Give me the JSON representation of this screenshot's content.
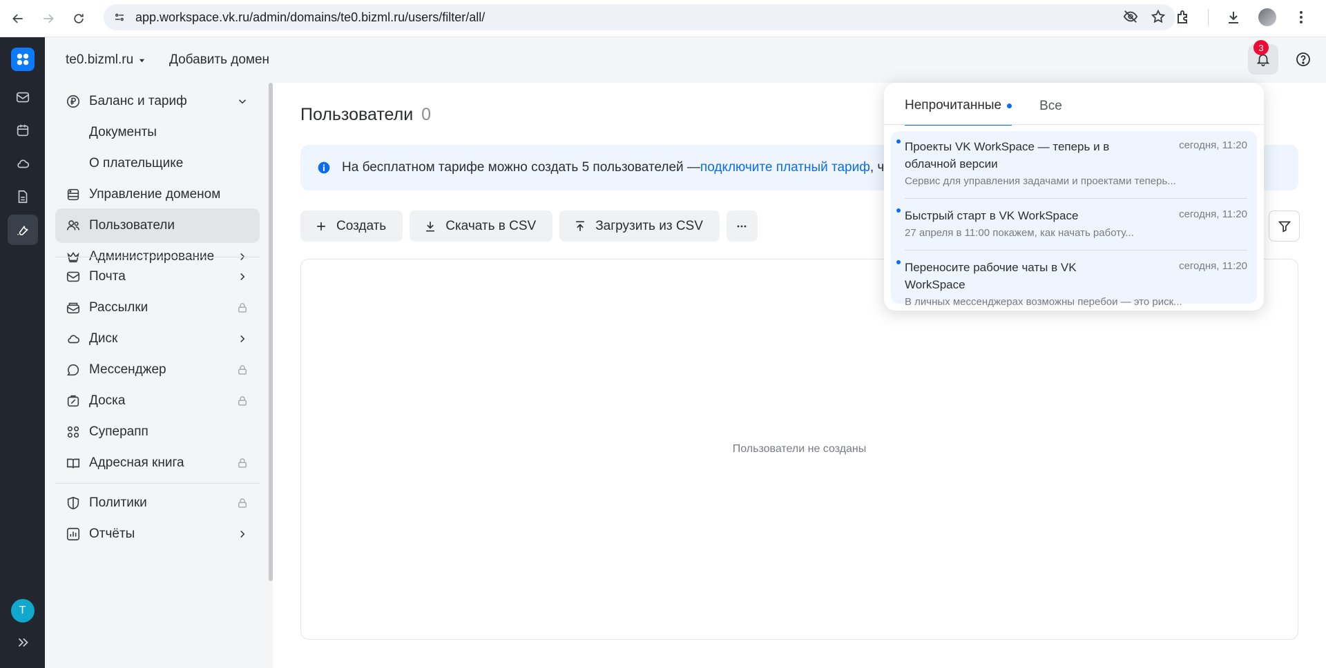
{
  "browser": {
    "url": "app.workspace.vk.ru/admin/domains/te0.bizml.ru/users/filter/all/"
  },
  "rail": {
    "avatar_letter": "T",
    "items": [
      "mail-icon",
      "calendar-icon",
      "cloud-icon",
      "document-icon",
      "admin-tools-icon"
    ]
  },
  "header": {
    "domain": "te0.bizml.ru",
    "add_domain": "Добавить домен",
    "notification_count": "3"
  },
  "sidebar": {
    "items": [
      {
        "label": "Баланс и тариф",
        "icon": "ruble-icon",
        "trail": "chevron-down"
      },
      {
        "label": "Документы"
      },
      {
        "label": "О плательщике"
      },
      {
        "label": "Управление доменом",
        "icon": "server-icon"
      },
      {
        "label": "Пользователи",
        "icon": "users-icon",
        "active": true
      },
      {
        "label": "Администрирование",
        "icon": "crown-icon",
        "trail": "chevron-right"
      },
      {
        "label": "Почта",
        "icon": "mail-icon",
        "trail": "chevron-right"
      },
      {
        "label": "Рассылки",
        "icon": "newsletter-icon",
        "trail": "lock"
      },
      {
        "label": "Диск",
        "icon": "cloud-icon",
        "trail": "chevron-right"
      },
      {
        "label": "Мессенджер",
        "icon": "chat-icon",
        "trail": "lock"
      },
      {
        "label": "Доска",
        "icon": "board-icon",
        "trail": "lock"
      },
      {
        "label": "Суперапп",
        "icon": "apps-icon"
      },
      {
        "label": "Адресная книга",
        "icon": "address-book-icon",
        "trail": "lock"
      },
      {
        "label": "Политики",
        "icon": "shield-icon",
        "trail": "lock"
      },
      {
        "label": "Отчёты",
        "icon": "chart-icon",
        "trail": "chevron-right"
      }
    ]
  },
  "main": {
    "title": "Пользователи",
    "count": "0",
    "banner": {
      "text": "На бесплатном тарифе можно создать 5 пользователей — ",
      "link": "подключите платный тариф",
      "after": ", чт"
    },
    "toolbar": {
      "create": "Создать",
      "download_csv": "Скачать в CSV",
      "upload_csv": "Загрузить из CSV"
    },
    "empty_text": "Пользователи не созданы"
  },
  "notifications": {
    "tabs": {
      "unread": "Непрочитанные",
      "all": "Все"
    },
    "items": [
      {
        "title": "Проекты VK WorkSpace — теперь и в облачной версии",
        "time": "сегодня, 11:20",
        "text": "Сервис для управления задачами и проектами теперь..."
      },
      {
        "title": "Быстрый старт в VK WorkSpace",
        "time": "сегодня, 11:20",
        "text": "27 апреля в 11:00 покажем, как начать работу..."
      },
      {
        "title": "Переносите рабочие чаты в VK WorkSpace",
        "time": "сегодня, 11:20",
        "text": "В личных мессенджерах возможны перебои — это риск..."
      }
    ]
  },
  "colors": {
    "accent": "#0b6cf0",
    "rail_bg": "#22272f",
    "badge": "#ed0a34",
    "sidebar_bg": "#f4f5f7"
  }
}
